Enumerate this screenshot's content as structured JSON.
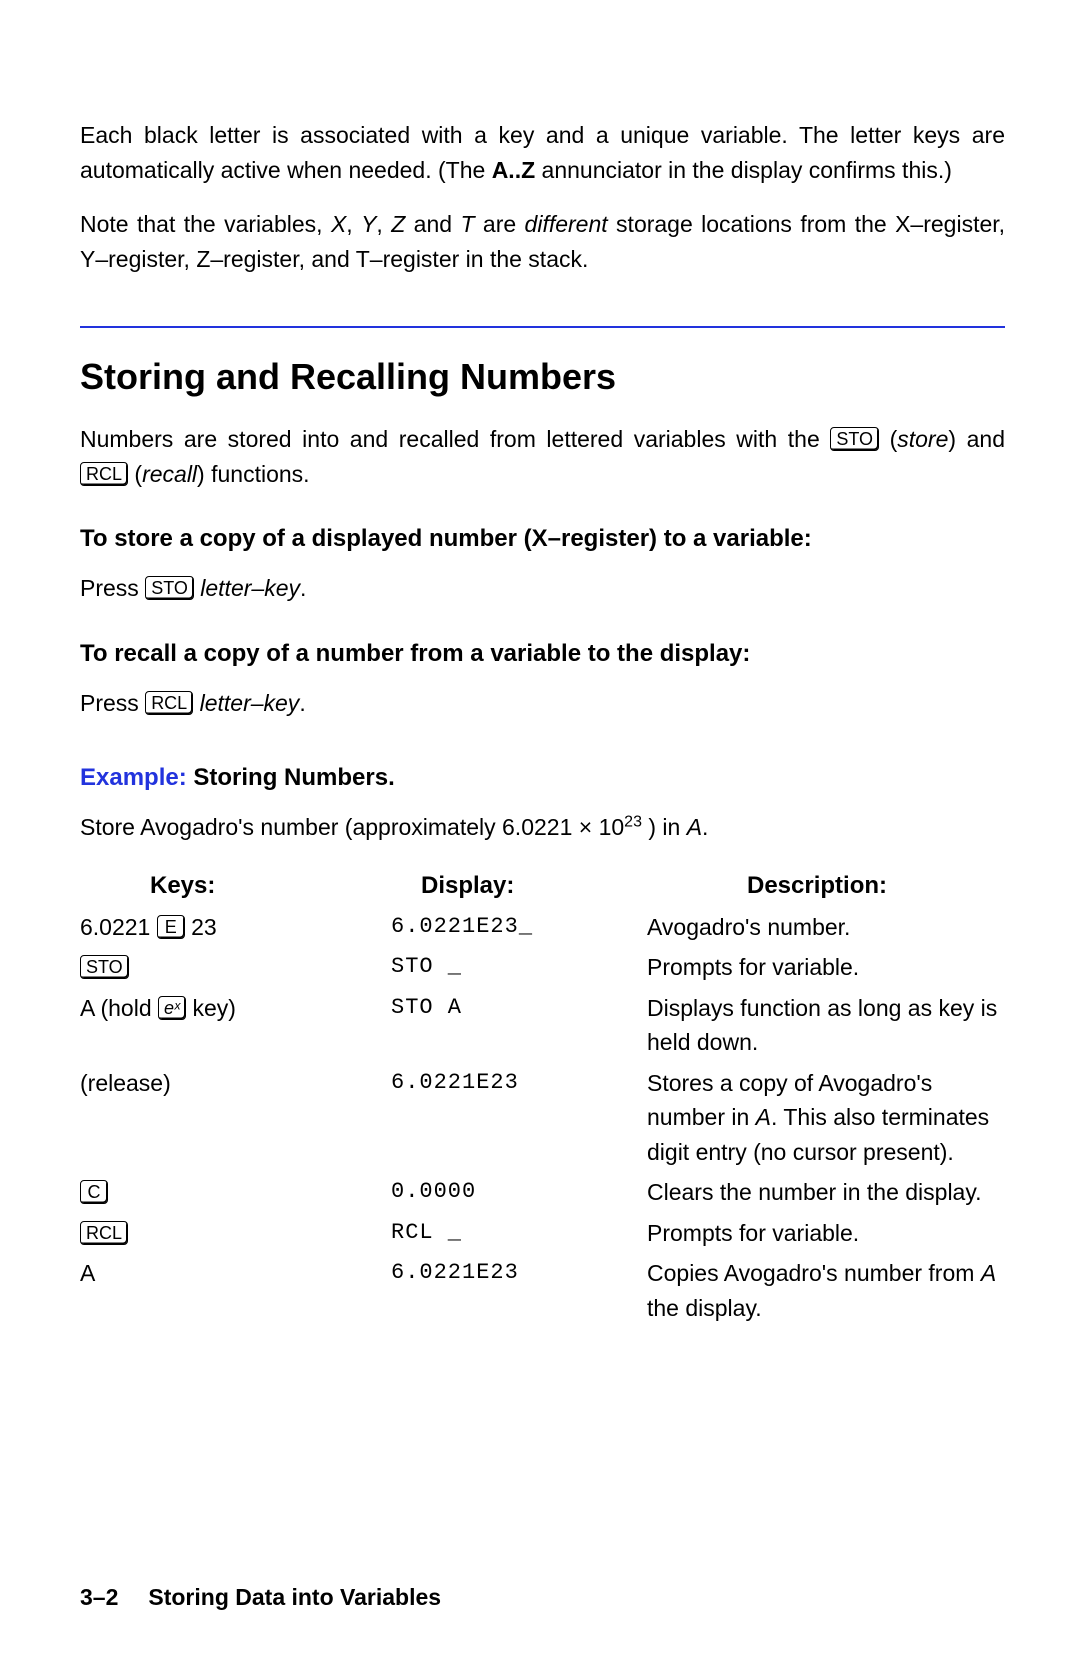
{
  "intro": {
    "p1a": "Each black letter is associated with a key and a unique variable. The letter keys are automatically active when needed. (The ",
    "p1b": "A..Z",
    "p1c": " annunciator in the display confirms this.)",
    "p2a": "Note that the variables, ",
    "p2b": "X",
    "p2c": ", ",
    "p2d": "Y",
    "p2e": ", ",
    "p2f": "Z",
    "p2g": " and ",
    "p2h": "T",
    "p2i": " are ",
    "p2j": "different",
    "p2k": " storage locations from the X–register, Y–register, Z–register, and T–register in the stack."
  },
  "heading": "Storing and Recalling Numbers",
  "section": {
    "s1a": "Numbers are stored into and recalled from lettered variables with the ",
    "s1b": "STO",
    "s1c": " (",
    "s1d": "store",
    "s1e": ") and ",
    "s1f": "RCL",
    "s1g": "  (",
    "s1h": "recall",
    "s1i": ") functions."
  },
  "sub1": "To store a copy of a displayed number (X–register) to a variable:",
  "sub1_body_a": "Press ",
  "sub1_key": "STO",
  "sub1_body_b": " letter–key",
  "sub1_body_c": ".",
  "sub2": "To recall a copy of a number from a variable to the display:",
  "sub2_body_a": "Press ",
  "sub2_key": "RCL",
  "sub2_body_b": " letter–key",
  "sub2_body_c": ".",
  "example_label": "Example:",
  "example_title": " Storing Numbers.",
  "example_intro_a": "Store Avogadro's number (approximately 6.0221 × 10",
  "example_intro_sup": "23",
  "example_intro_b": " ) in ",
  "example_intro_c": "A",
  "example_intro_d": ".",
  "table": {
    "h1": "Keys:",
    "h2": "Display:",
    "h3": "Description:",
    "rows": [
      {
        "k_pre": "6.0221 ",
        "k_key": "E",
        "k_post": " 23",
        "disp": "6.0221E23_",
        "desc": "Avogadro's number."
      },
      {
        "k_pre": "",
        "k_key": "STO",
        "k_post": "",
        "disp": "STO _",
        "desc": "Prompts for variable."
      },
      {
        "k_pre": "A (hold ",
        "k_key": "eˣ",
        "k_post": " key)",
        "disp": "STO A",
        "desc": "Displays function as long as key is held down."
      },
      {
        "k_pre": "(release)",
        "k_key": "",
        "k_post": "",
        "disp": "6.0221E23",
        "desc_a": "Stores a copy of Avogadro's number in ",
        "desc_i": "A",
        "desc_b": ". This also terminates digit entry (no cursor present)."
      },
      {
        "k_pre": "",
        "k_key": "C",
        "k_post": "",
        "disp": "0.0000",
        "desc": "Clears the number in the display."
      },
      {
        "k_pre": "",
        "k_key": "RCL",
        "k_post": "",
        "disp": "RCL _",
        "desc": "Prompts for variable."
      },
      {
        "k_pre": "A",
        "k_key": "",
        "k_post": "",
        "disp": "6.0221E23",
        "desc_a": "Copies Avogadro's number from ",
        "desc_i": "A",
        "desc_b": " the display."
      }
    ]
  },
  "footer": {
    "page": "3–2",
    "title": "Storing Data into Variables"
  }
}
